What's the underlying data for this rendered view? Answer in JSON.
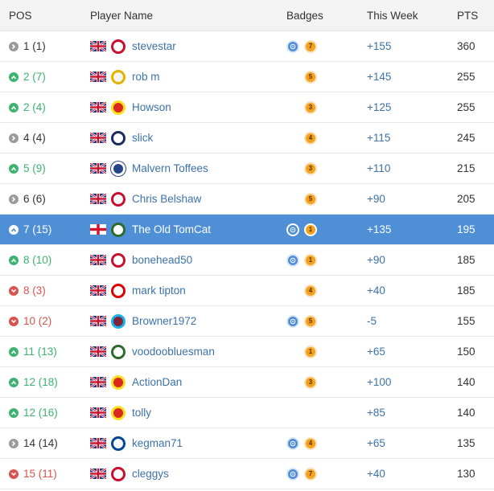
{
  "headers": {
    "pos": "POS",
    "player": "Player Name",
    "badges": "Badges",
    "week": "This Week",
    "pts": "PTS"
  },
  "colors": {
    "up": "#3cb371",
    "down": "#d9534f",
    "same": "#9a9a9a",
    "highlight": "#4e8fd6",
    "link": "#3d72a8"
  },
  "rows": [
    {
      "trend": "same",
      "pos": "1 (1)",
      "flag": "uk",
      "crest": "crest-red-white",
      "name": "stevestar",
      "blue_badge": true,
      "orange_badge": "7",
      "week": "+155",
      "pts": "360"
    },
    {
      "trend": "up",
      "pos": "2 (7)",
      "flag": "uk",
      "crest": "crest-yellow-white",
      "name": "rob m",
      "blue_badge": false,
      "orange_badge": "5",
      "week": "+145",
      "pts": "255"
    },
    {
      "trend": "up",
      "pos": "2 (4)",
      "flag": "uk",
      "crest": "crest-red",
      "name": "Howson",
      "blue_badge": false,
      "orange_badge": "3",
      "week": "+125",
      "pts": "255"
    },
    {
      "trend": "same",
      "pos": "4 (4)",
      "flag": "uk",
      "crest": "crest-white-blue",
      "name": "slick",
      "blue_badge": false,
      "orange_badge": "4",
      "week": "+115",
      "pts": "245"
    },
    {
      "trend": "up",
      "pos": "5 (9)",
      "flag": "uk",
      "crest": "crest-blue",
      "name": "Malvern Toffees",
      "blue_badge": false,
      "orange_badge": "3",
      "week": "+110",
      "pts": "215"
    },
    {
      "trend": "same",
      "pos": "6 (6)",
      "flag": "uk",
      "crest": "crest-red-liver",
      "name": "Chris Belshaw",
      "blue_badge": false,
      "orange_badge": "5",
      "week": "+90",
      "pts": "205"
    },
    {
      "trend": "up",
      "pos": "7 (15)",
      "flag": "england",
      "crest": "crest-green-white",
      "name": "The Old TomCat",
      "blue_badge": true,
      "orange_badge": "1",
      "week": "+135",
      "pts": "195",
      "highlight": true
    },
    {
      "trend": "up",
      "pos": "8 (10)",
      "flag": "uk",
      "crest": "crest-red-white",
      "name": "bonehead50",
      "blue_badge": true,
      "orange_badge": "1",
      "week": "+90",
      "pts": "185"
    },
    {
      "trend": "down",
      "pos": "8 (3)",
      "flag": "uk",
      "crest": "crest-red-tree",
      "name": "mark tipton",
      "blue_badge": false,
      "orange_badge": "4",
      "week": "+40",
      "pts": "185"
    },
    {
      "trend": "down",
      "pos": "10 (2)",
      "flag": "uk",
      "crest": "crest-claret",
      "name": "Browner1972",
      "blue_badge": true,
      "orange_badge": "5",
      "week": "-5",
      "pts": "155"
    },
    {
      "trend": "up",
      "pos": "11 (13)",
      "flag": "uk",
      "crest": "crest-green-white",
      "name": "voodoobluesman",
      "blue_badge": false,
      "orange_badge": "1",
      "week": "+65",
      "pts": "150"
    },
    {
      "trend": "up",
      "pos": "12 (18)",
      "flag": "uk",
      "crest": "crest-red",
      "name": "ActionDan",
      "blue_badge": false,
      "orange_badge": "3",
      "week": "+100",
      "pts": "140"
    },
    {
      "trend": "up",
      "pos": "12 (16)",
      "flag": "uk",
      "crest": "crest-red",
      "name": "tolly",
      "blue_badge": false,
      "orange_badge": "",
      "week": "+85",
      "pts": "140"
    },
    {
      "trend": "same",
      "pos": "14 (14)",
      "flag": "uk",
      "crest": "crest-navy",
      "name": "kegman71",
      "blue_badge": true,
      "orange_badge": "4",
      "week": "+65",
      "pts": "135"
    },
    {
      "trend": "down",
      "pos": "15 (11)",
      "flag": "uk",
      "crest": "crest-red-liver",
      "name": "cleggys",
      "blue_badge": true,
      "orange_badge": "7",
      "week": "+40",
      "pts": "130"
    }
  ]
}
